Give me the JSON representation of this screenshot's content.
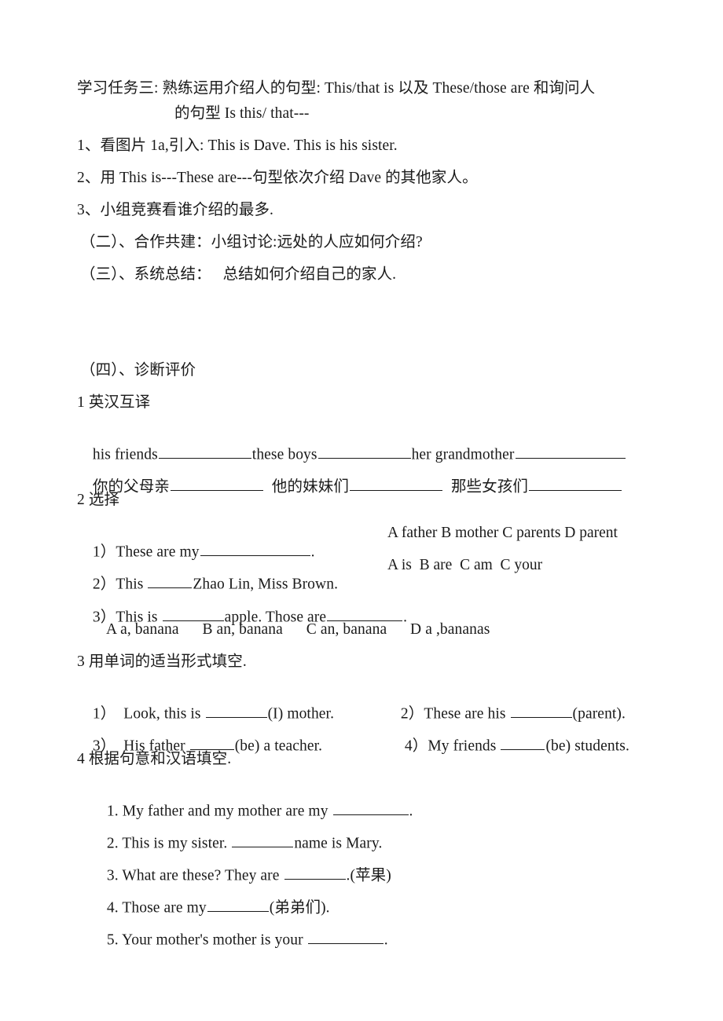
{
  "document": {
    "title_line_1": "学习任务三: 熟练运用介绍人的句型: This/that is 以及 These/those are 和询问人",
    "title_line_2": "的句型 Is this/ that---",
    "steps": [
      "1、看图片 1a,引入: This is Dave. This is his sister.",
      "2、用 This is---These are---句型依次介绍 Dave 的其他家人。",
      "3、小组竞赛看谁介绍的最多."
    ],
    "sections": [
      "（二）、合作共建：小组讨论:远处的人应如何介绍?",
      "（三）、系统总结：   总结如何介绍自己的家人."
    ],
    "evaluation_heading": "（四）、诊断评价",
    "ex1": {
      "heading": "1 英汉互译",
      "row1_item1": "his friends",
      "row1_item2": "these boys",
      "row1_item3": "her grandmother",
      "row2_item1": "你的父母亲",
      "row2_item2": "他的妹妹们",
      "row2_item3": "那些女孩们"
    },
    "ex2": {
      "heading": "2 选择",
      "q1_num": "1）",
      "q1_text_a": "These are my",
      "q1_text_b": ".",
      "q1_options": "A father B mother C parents D parent",
      "q2_num": "2）",
      "q2_text_a": "This ",
      "q2_text_b": "Zhao Lin, Miss Brown.",
      "q2_options": "A is  B are  C am  C your",
      "q3_num": "3）",
      "q3_text_a": "This is ",
      "q3_text_b": "apple. Those are",
      "q3_text_c": ".",
      "q3_options": "A a, banana      B an, banana      C an, banana      D a ,bananas"
    },
    "ex3": {
      "heading": "3 用单词的适当形式填空.",
      "q1_num": "1）",
      "q1_text_a": "  Look, this is ",
      "q1_text_b": "(I) mother.",
      "q2_num": "2）",
      "q2_text_a": "These are his ",
      "q2_text_b": "(parent).",
      "q3_num": "3）",
      "q3_text_a": "  His father ",
      "q3_text_b": "(be) a teacher.",
      "q4_num": "4）",
      "q4_text_a": "My friends ",
      "q4_text_b": "(be) students."
    },
    "ex4": {
      "heading": "4 根据句意和汉语填空.",
      "q1_a": "1. My father and my mother are my ",
      "q1_b": ".",
      "q2_a": "2. This is my sister. ",
      "q2_b": "name is Mary.",
      "q3_a": "3. What are these? They are ",
      "q3_b": ".(苹果)",
      "q4_a": "4. Those are my",
      "q4_b": "(弟弟们).",
      "q5_a": "5. Your mother's mother is your ",
      "q5_b": "."
    }
  }
}
